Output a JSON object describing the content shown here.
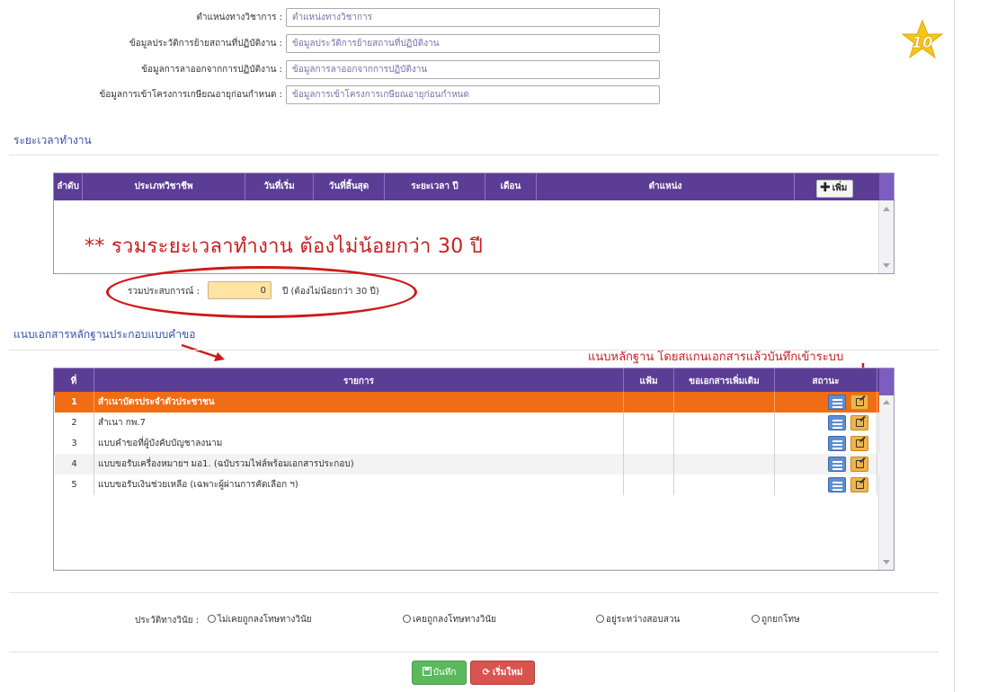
{
  "form": {
    "fields": [
      {
        "label": "ตำแหน่งทางวิชาการ :",
        "placeholder": "ตำแหน่งทางวิชาการ"
      },
      {
        "label": "ข้อมูลประวัติการย้ายสถานที่ปฏิบัติงาน :",
        "placeholder": "ข้อมูลประวัติการย้ายสถานที่ปฏิบัติงาน"
      },
      {
        "label": "ข้อมูลการลาออกจากการปฏิบัติงาน :",
        "placeholder": "ข้อมูลการลาออกจากการปฏิบัติงาน"
      },
      {
        "label": "ข้อมูลการเข้าโครงการเกษียณอายุก่อนกำหนด :",
        "placeholder": "ข้อมูลการเข้าโครงการเกษียณอายุก่อนกำหนด"
      }
    ]
  },
  "logo": {
    "icon": "star-10-icon",
    "text": "10",
    "color": "#f5c518"
  },
  "work_period": {
    "title": "ระยะเวลาทำงาน",
    "columns": [
      "ลำดับ",
      "ประเภทวิชาชีพ",
      "วันที่เริ่ม",
      "วันที่สิ้นสุด",
      "ระยะเวลา ปี",
      "เดือน",
      "ตำแหน่ง"
    ],
    "add_label": "เพิ่ม",
    "warning": "** รวมระยะเวลาทำงาน ต้องไม่น้อยกว่า 30 ปี",
    "sum_label": "รวมประสบการณ์ :",
    "sum_value": "0",
    "sum_note": "ปี (ต้องไม่น้อยกว่า 30 ปี)"
  },
  "documents": {
    "title": "แนบเอกสารหลักฐานประกอบแบบคำขอ",
    "annotation": "แนบหลักฐาน โดยสแกนเอกสารแล้วบันทึกเข้าระบบ",
    "columns": [
      "ที่",
      "รายการ",
      "แฟ้ม",
      "ขอเอกสารเพิ่มเติม",
      "สถานะ",
      "*"
    ],
    "rows": [
      {
        "no": "1",
        "name": "สำเนาบัตรประจำตัวประชาชน",
        "selected": true
      },
      {
        "no": "2",
        "name": "สำเนา กพ.7",
        "selected": false
      },
      {
        "no": "3",
        "name": "แบบคำขอที่ผู้บังคับบัญชาลงนาม",
        "selected": false
      },
      {
        "no": "4",
        "name": "แบบขอรับเครื่องหมายฯ มอ1. (ฉบับรวมไฟล์พร้อมเอกสารประกอบ)",
        "selected": false
      },
      {
        "no": "5",
        "name": "แบบขอรับเงินช่วยเหลือ (เฉพาะผู้ผ่านการคัดเลือก ฯ)",
        "selected": false
      }
    ]
  },
  "discipline": {
    "label": "ประวัติทางวินัย :",
    "options": [
      "ไม่เคยถูกลงโทษทางวินัย",
      "เคยถูกลงโทษทางวินัย",
      "อยู่ระหว่างสอบสวน",
      "ถูกยกโทษ"
    ]
  },
  "actions": {
    "save_label": "บันทึก",
    "reset_label": "เริ่มใหม่"
  },
  "colors": {
    "header": "#5b3d96",
    "selected_row": "#f06d14",
    "annotation": "#c81e1e",
    "save": "#5cb85c",
    "reset": "#d9534f"
  }
}
